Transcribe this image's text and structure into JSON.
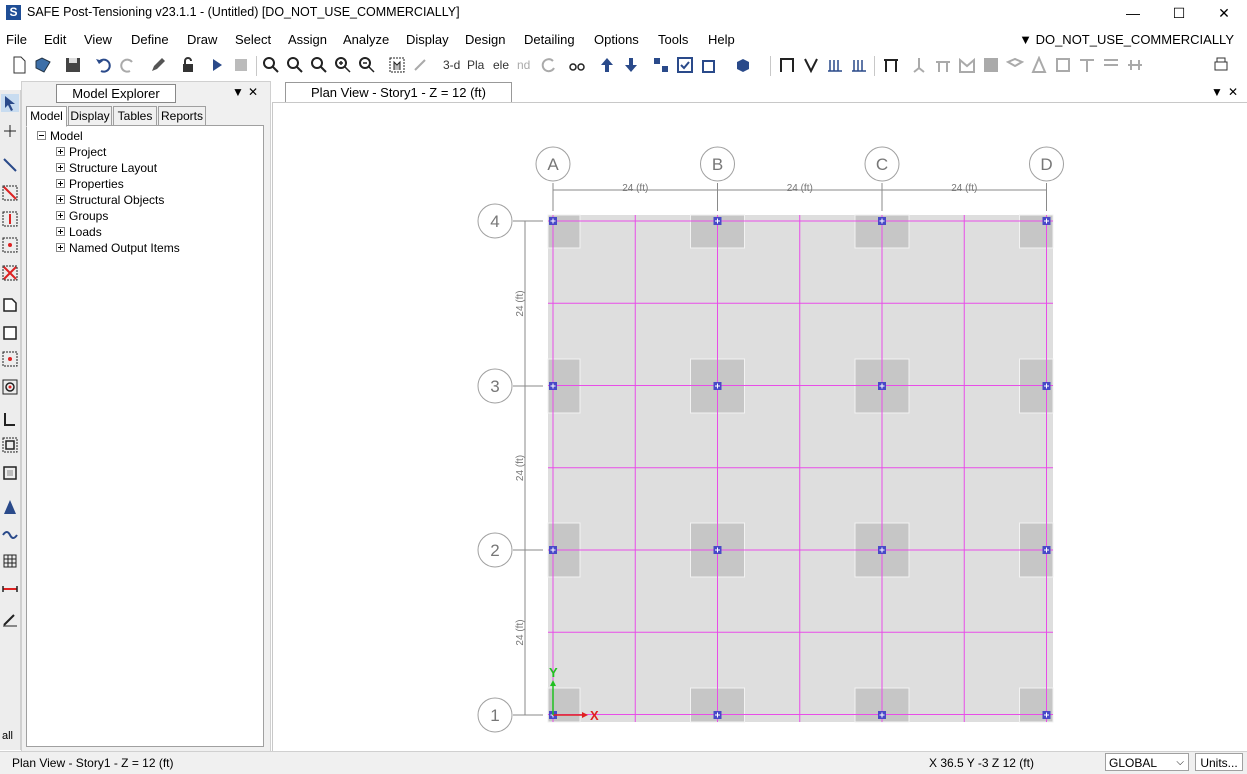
{
  "window": {
    "title": "SAFE Post-Tensioning v23.1.1 - (Untitled)  [DO_NOT_USE_COMMERCIALLY]",
    "app_icon_letter": "S",
    "minimize": "—",
    "maximize": "☐",
    "close": "✕"
  },
  "menu": {
    "items": [
      "File",
      "Edit",
      "View",
      "Define",
      "Draw",
      "Select",
      "Assign",
      "Analyze",
      "Display",
      "Design",
      "Detailing",
      "Options",
      "Tools",
      "Help"
    ],
    "license_label": "▼ DO_NOT_USE_COMMERCIALLY"
  },
  "toolbar": {
    "text_3d": "3-d",
    "text_pla": "Pla",
    "text_ele": "ele",
    "text_nd": "nd"
  },
  "left_tools": {
    "all_label": "all"
  },
  "explorer": {
    "title": "Model Explorer",
    "pin": "▼",
    "close": "✕",
    "tabs": [
      "Model",
      "Display",
      "Tables",
      "Reports"
    ],
    "active_tab": "Model",
    "root": "Model",
    "items": [
      "Project",
      "Structure Layout",
      "Properties",
      "Structural Objects",
      "Groups",
      "Loads",
      "Named Output Items"
    ]
  },
  "view": {
    "tab_label": "Plan View - Story1 - Z = 12 (ft)",
    "pin": "▼",
    "close": "✕"
  },
  "plan": {
    "grid_columns": [
      "A",
      "B",
      "C",
      "D"
    ],
    "grid_rows": [
      "4",
      "3",
      "2",
      "1"
    ],
    "spacing_label": "24 (ft)",
    "axis_x_label": "X",
    "axis_y_label": "Y",
    "colors": {
      "slab": "#dedede",
      "column_patch": "#c6c6c6",
      "grid_line": "#e84de8",
      "dimension": "#8a8a8a",
      "bubble": "#a0a0a0",
      "column_point": "#4848c8",
      "axis_x": "#e02020",
      "axis_y": "#20c020"
    }
  },
  "status": {
    "left": "Plan View - Story1 - Z = 12 (ft)",
    "coords": "X 36.5  Y -3  Z 12 (ft)",
    "coord_system": "GLOBAL",
    "units_button": "Units..."
  }
}
